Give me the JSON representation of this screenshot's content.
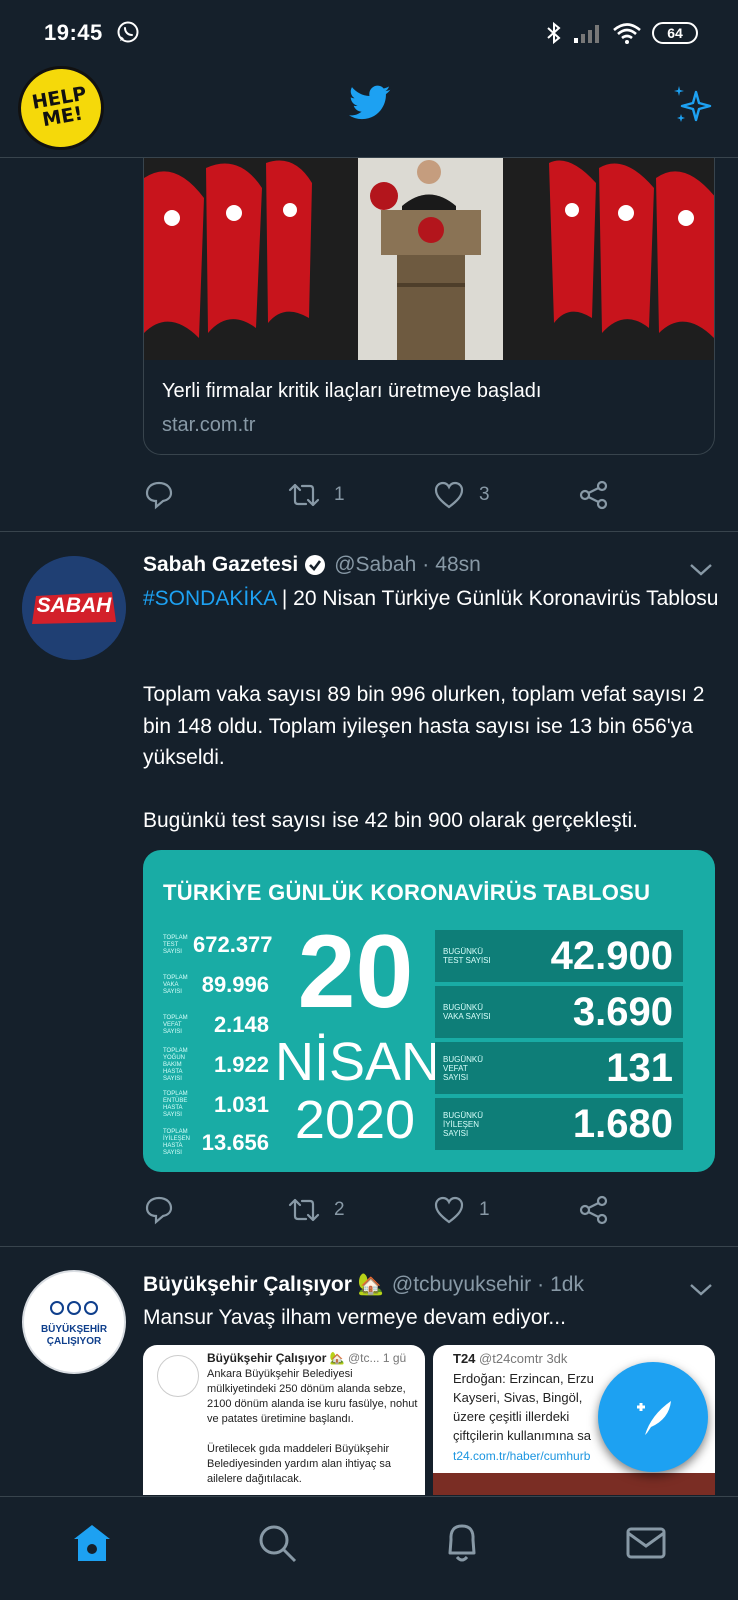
{
  "status_bar": {
    "time": "19:45",
    "battery": "64"
  },
  "header": {
    "badge_line1": "HELP",
    "badge_line2": "ME!",
    "logo_icon": "twitter-bird-icon",
    "sparkle_icon": "sparkle-icon"
  },
  "card": {
    "title": "Yerli firmalar kritik ilaçları üretmeye başladı",
    "domain": "star.com.tr"
  },
  "tweet1_actions": {
    "retweets": "1",
    "likes": "3"
  },
  "tweet2": {
    "avatar_text": "SABAH",
    "name": "Sabah Gazetesi",
    "handle": "@Sabah",
    "time": "48sn",
    "hashtag": "#SONDAKİKA",
    "headline": " | 20 Nisan Türkiye Günlük Koronavirüs Tablosu",
    "body": "Toplam vaka sayısı 89 bin 996 olurken, toplam vefat sayısı 2 bin 148 oldu. Toplam iyileşen hasta sayısı ise 13 bin 656'ya yükseldi.\n\nBugünkü test sayısı ise 42 bin 900 olarak gerçekleşti.",
    "retweets": "2",
    "likes": "1"
  },
  "covid_card": {
    "title": "TÜRKİYE GÜNLÜK KORONAVİRÜS TABLOSU",
    "left": [
      {
        "label": "TOPLAM TEST SAYISI",
        "value": "672.377"
      },
      {
        "label": "TOPLAM VAKA SAYISI",
        "value": "89.996"
      },
      {
        "label": "TOPLAM VEFAT SAYISI",
        "value": "2.148"
      },
      {
        "label": "TOPLAM YOĞUN BAKIM HASTA SAYISI",
        "value": "1.922"
      },
      {
        "label": "TOPLAM ENTÜBE HASTA SAYISI",
        "value": "1.031"
      },
      {
        "label": "TOPLAM İYİLEŞEN HASTA SAYISI",
        "value": "13.656"
      }
    ],
    "day": "20",
    "month": "NİSAN",
    "year": "2020",
    "right": [
      {
        "label": "BUGÜNKÜ TEST SAYISI",
        "value": "42.900"
      },
      {
        "label": "BUGÜNKÜ VAKA SAYISI",
        "value": "3.690"
      },
      {
        "label": "BUGÜNKÜ VEFAT SAYISI",
        "value": "131"
      },
      {
        "label": "BUGÜNKÜ İYİLEŞEN SAYISI",
        "value": "1.680"
      }
    ]
  },
  "tweet3": {
    "avatar_line1": "BÜYÜKŞEHİR",
    "avatar_line2": "ÇALIŞIYOR",
    "name": "Büyükşehir Çalışıyor 🏡",
    "handle": "@tcbuyuksehir",
    "time": "1dk",
    "text": "Mansur Yavaş ilham vermeye devam ediyor...",
    "thumb1": {
      "name": "Büyükşehir Çalışıyor 🏡",
      "handle": "@tc...",
      "time": "1 gü",
      "text": "Ankara Büyükşehir Belediyesi mülkiyetindeki 250 dönüm alanda sebze, 2100 dönüm alanda ise kuru fasülye, nohut ve patates üretimine başlandı.\n\nÜretilecek gıda maddeleri Büyükşehir Belediyesinden yardım alan ihtiyaç sa ailelere dağıtılacak."
    },
    "thumb2": {
      "name": "T24",
      "handle": "@t24comtr",
      "time": "3dk",
      "text": "Erdoğan: Erzincan, Erzu Kayseri, Sivas, Bingöl, üzere çeşitli illerdeki çiftçilerin kullanımına sa",
      "link": "t24.com.tr/haber/cumhurb"
    }
  },
  "bottom_nav": [
    "home-icon",
    "search-icon",
    "notifications-icon",
    "messages-icon"
  ]
}
